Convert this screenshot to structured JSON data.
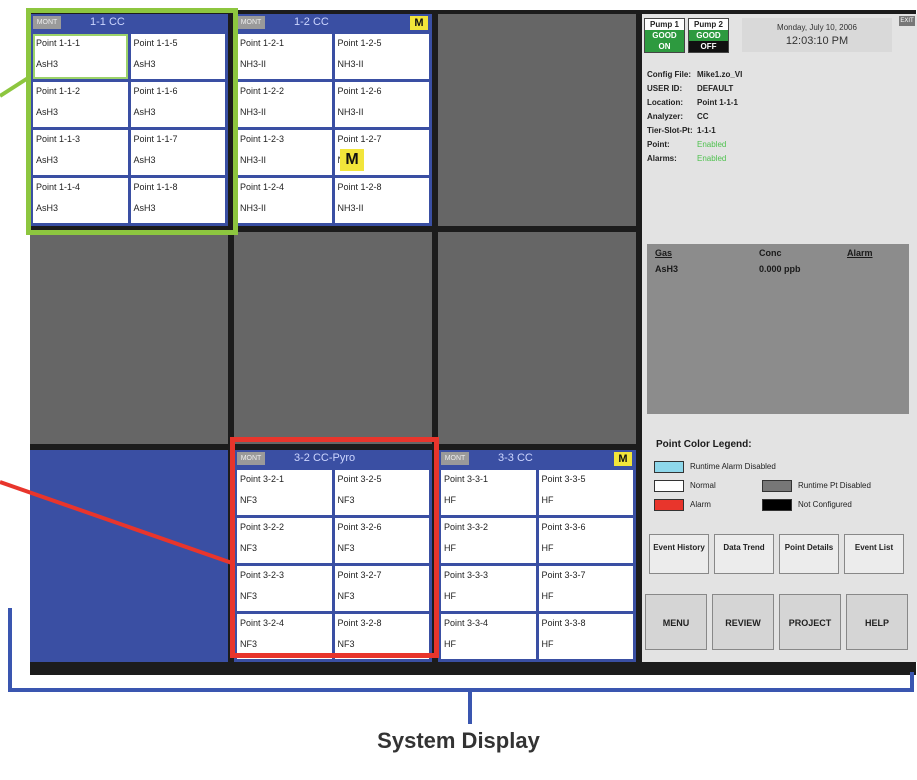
{
  "topbar": {
    "pump1": {
      "label": "Pump 1",
      "status": "GOOD",
      "state": "ON"
    },
    "pump2": {
      "label": "Pump 2",
      "status": "GOOD",
      "state": "OFF"
    },
    "date": "Monday, July 10, 2006",
    "time": "12:03:10 PM",
    "exit_label": "EXIT"
  },
  "modules": [
    {
      "id": "m11",
      "mont": "MONT",
      "title": "1-1  CC",
      "m_badge": "",
      "points": [
        [
          "Point 1-1-1",
          "AsH3"
        ],
        [
          "Point 1-1-5",
          "AsH3"
        ],
        [
          "Point 1-1-2",
          "AsH3"
        ],
        [
          "Point 1-1-6",
          "AsH3"
        ],
        [
          "Point 1-1-3",
          "AsH3"
        ],
        [
          "Point 1-1-7",
          "AsH3"
        ],
        [
          "Point 1-1-4",
          "AsH3"
        ],
        [
          "Point 1-1-8",
          "AsH3"
        ]
      ]
    },
    {
      "id": "m12",
      "mont": "MONT",
      "title": "1-2  CC",
      "m_badge": "M",
      "points": [
        [
          "Point 1-2-1",
          "NH3-II"
        ],
        [
          "Point 1-2-5",
          "NH3-II"
        ],
        [
          "Point 1-2-2",
          "NH3-II"
        ],
        [
          "Point 1-2-6",
          "NH3-II"
        ],
        [
          "Point 1-2-3",
          "NH3-II"
        ],
        [
          "Point 1-2-7",
          "NH3-II"
        ],
        [
          "Point 1-2-4",
          "NH3-II"
        ],
        [
          "Point 1-2-8",
          "NH3-II"
        ]
      ]
    },
    {
      "id": "m32",
      "mont": "MONT",
      "title": "3-2  CC-Pyro",
      "m_badge": "",
      "points": [
        [
          "Point 3-2-1",
          "NF3"
        ],
        [
          "Point 3-2-5",
          "NF3"
        ],
        [
          "Point 3-2-2",
          "NF3"
        ],
        [
          "Point 3-2-6",
          "NF3"
        ],
        [
          "Point 3-2-3",
          "NF3"
        ],
        [
          "Point 3-2-7",
          "NF3"
        ],
        [
          "Point 3-2-4",
          "NF3"
        ],
        [
          "Point 3-2-8",
          "NF3"
        ]
      ]
    },
    {
      "id": "m33",
      "mont": "MONT",
      "title": "3-3  CC",
      "m_badge": "M",
      "points": [
        [
          "Point 3-3-1",
          "HF"
        ],
        [
          "Point 3-3-5",
          "HF"
        ],
        [
          "Point 3-3-2",
          "HF"
        ],
        [
          "Point 3-3-6",
          "HF"
        ],
        [
          "Point 3-3-3",
          "HF"
        ],
        [
          "Point 3-3-7",
          "HF"
        ],
        [
          "Point 3-3-4",
          "HF"
        ],
        [
          "Point 3-3-8",
          "HF"
        ]
      ]
    }
  ],
  "big_m": "M",
  "info": {
    "config_key": "Config File:",
    "config_val": "Mike1.zo_VI",
    "user_key": "USER ID:",
    "user_val": "DEFAULT",
    "location_key": "Location:",
    "location_val": "Point 1-1-1",
    "analyzer_key": "Analyzer:",
    "analyzer_val": "CC",
    "tsp_key": "Tier-Slot-Pt:",
    "tsp_val": "1-1-1",
    "point_key": "Point:",
    "point_val": "Enabled",
    "alarms_key": "Alarms:",
    "alarms_val": "Enabled"
  },
  "gas": {
    "h_gas": "Gas",
    "h_conc": "Conc",
    "h_alarm": "Alarm",
    "gas": "AsH3",
    "conc": "0.000  ppb"
  },
  "legend": {
    "title": "Point Color Legend:",
    "runtime_alarm_disabled": "Runtime Alarm Disabled",
    "normal": "Normal",
    "runtime_pt_disabled": "Runtime Pt Disabled",
    "alarm": "Alarm",
    "not_configured": "Not Configured",
    "colors": {
      "runtime_alarm_disabled": "#8ed7ea",
      "normal": "#ffffff",
      "runtime_pt_disabled": "#777777",
      "alarm": "#e8352c",
      "not_configured": "#000000"
    }
  },
  "buttons": {
    "event_history": "Event History",
    "data_trend": "Data Trend",
    "point_details": "Point Details",
    "event_list": "Event List",
    "menu": "MENU",
    "review": "REVIEW",
    "project": "PROJECT",
    "help": "HELP"
  },
  "caption": "System Display"
}
